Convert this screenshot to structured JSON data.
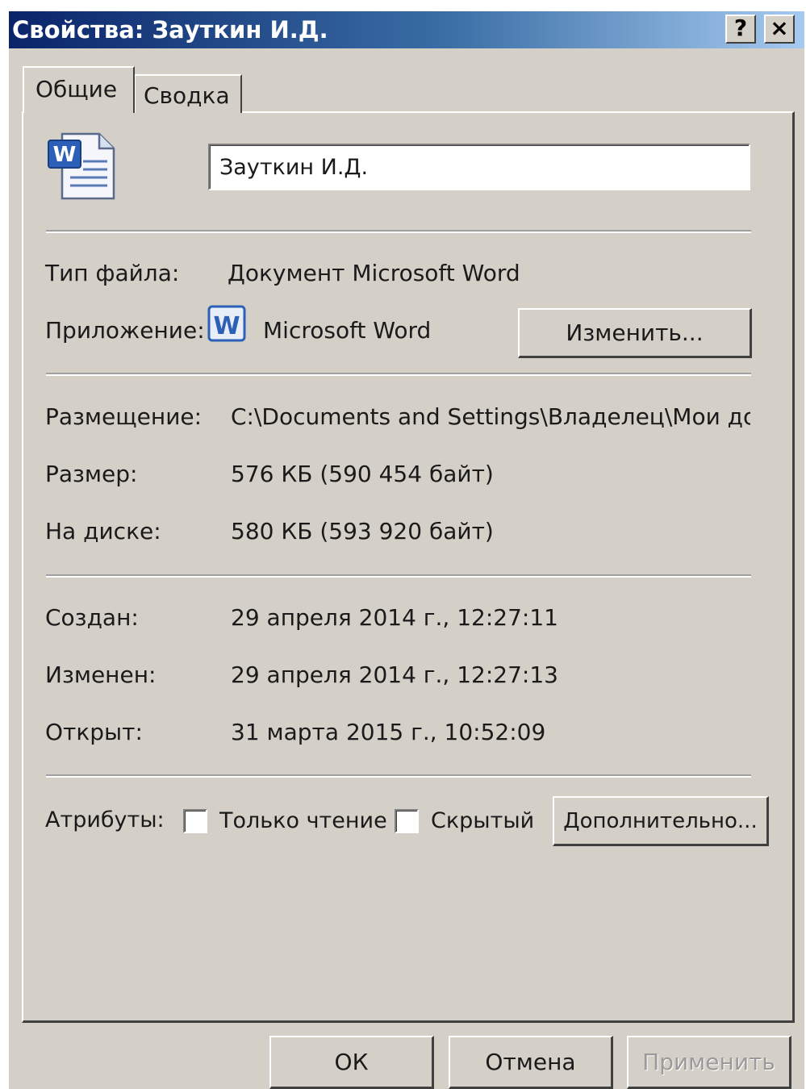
{
  "window": {
    "title": "Свойства: Зауткин И.Д.",
    "help_label": "?",
    "close_label": "×"
  },
  "tabs": [
    {
      "label": "Общие",
      "active": true
    },
    {
      "label": "Сводка",
      "active": false
    }
  ],
  "general": {
    "file_name": "Зауткин И.Д.",
    "file_type_label": "Тип файла:",
    "file_type_value": "Документ Microsoft Word",
    "app_label": "Приложение:",
    "app_value": "Microsoft Word",
    "change_button": "Изменить...",
    "location_label": "Размещение:",
    "location_value": "C:\\Documents and Settings\\Владелец\\Мои доку",
    "size_label": "Размер:",
    "size_value": "576 КБ (590 454 байт)",
    "ondisk_label": "На диске:",
    "ondisk_value": "580 КБ (593 920 байт)",
    "created_label": "Создан:",
    "created_value": "29 апреля 2014 г., 12:27:11",
    "modified_label": "Изменен:",
    "modified_value": "29 апреля 2014 г., 12:27:13",
    "opened_label": "Открыт:",
    "opened_value": "31 марта 2015 г., 10:52:09",
    "attributes_label": "Атрибуты:",
    "readonly_label": "Только чтение",
    "readonly_checked": false,
    "hidden_label": "Скрытый",
    "hidden_checked": false,
    "advanced_button": "Дополнительно..."
  },
  "footer": {
    "ok": "ОК",
    "cancel": "Отмена",
    "apply": "Применить"
  },
  "icons": {
    "document": "word-document-icon",
    "application": "word-app-icon"
  },
  "colors": {
    "title_gradient_start": "#0a246a",
    "title_gradient_end": "#a6caf0",
    "dialog_face": "#d4d0c8",
    "word_blue": "#2b5fb8"
  }
}
